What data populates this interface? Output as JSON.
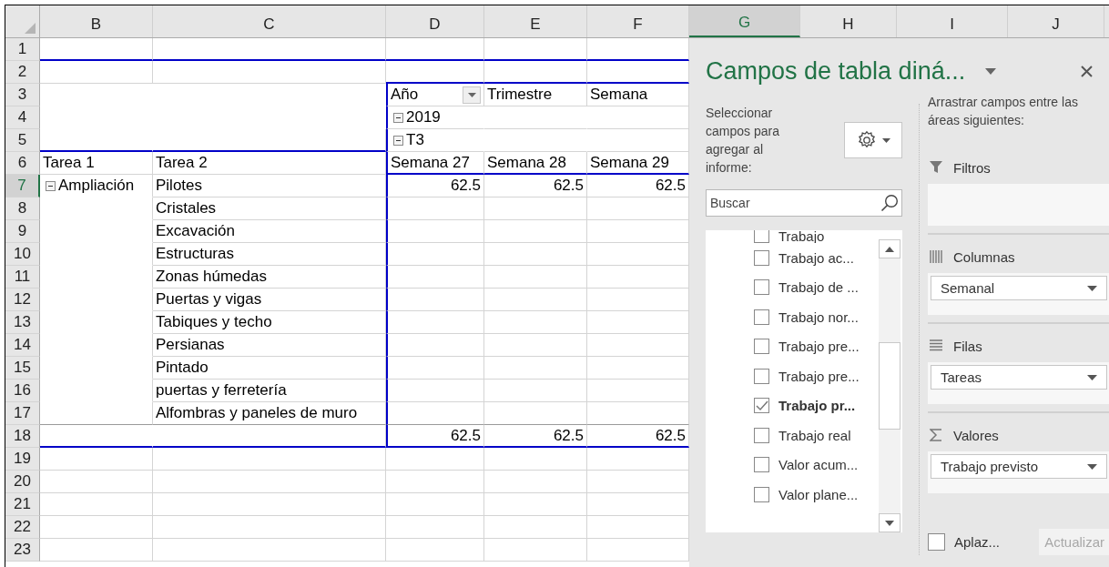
{
  "sheet": {
    "column_headers": [
      {
        "label": "B",
        "selected": false
      },
      {
        "label": "C",
        "selected": false
      },
      {
        "label": "D",
        "selected": false
      },
      {
        "label": "E",
        "selected": false
      },
      {
        "label": "F",
        "selected": false
      },
      {
        "label": "G",
        "selected": true
      },
      {
        "label": "H",
        "selected": false
      },
      {
        "label": "I",
        "selected": false
      },
      {
        "label": "J",
        "selected": false
      }
    ],
    "rows": [
      {
        "number": "1",
        "selected": false,
        "cells": [
          null,
          null,
          null,
          null,
          null
        ]
      },
      {
        "number": "2",
        "selected": false,
        "cells": [
          null,
          null,
          null,
          null,
          null
        ]
      },
      {
        "number": "3",
        "selected": false,
        "cells": [
          null,
          null,
          {
            "kind": "filter-header",
            "text": "Año"
          },
          {
            "kind": "label",
            "text": "Trimestre"
          },
          {
            "kind": "label",
            "text": "Semana"
          }
        ]
      },
      {
        "number": "4",
        "selected": false,
        "cells": [
          null,
          null,
          {
            "kind": "toggle",
            "text": "2019",
            "expanded": true
          },
          null,
          null
        ]
      },
      {
        "number": "5",
        "selected": false,
        "cells": [
          null,
          null,
          {
            "kind": "toggle",
            "text": "T3",
            "expanded": true
          },
          null,
          null
        ]
      },
      {
        "number": "6",
        "selected": false,
        "cells": [
          {
            "kind": "label",
            "text": "Tarea  1"
          },
          {
            "kind": "label",
            "text": "Tarea  2"
          },
          {
            "kind": "label",
            "text": "Semana 27"
          },
          {
            "kind": "label",
            "text": "Semana 28"
          },
          {
            "kind": "label",
            "text": "Semana 29"
          }
        ]
      },
      {
        "number": "7",
        "selected": true,
        "cells": [
          {
            "kind": "toggle",
            "text": "Ampliación",
            "expanded": true
          },
          {
            "kind": "label",
            "text": "Pilotes"
          },
          {
            "kind": "number",
            "text": "62.5"
          },
          {
            "kind": "number",
            "text": "62.5"
          },
          {
            "kind": "number",
            "text": "62.5"
          }
        ]
      },
      {
        "number": "8",
        "selected": false,
        "cells": [
          null,
          {
            "kind": "label",
            "text": "Cristales"
          },
          null,
          null,
          null
        ]
      },
      {
        "number": "9",
        "selected": false,
        "cells": [
          null,
          {
            "kind": "label",
            "text": "Excavación"
          },
          null,
          null,
          null
        ]
      },
      {
        "number": "10",
        "selected": false,
        "cells": [
          null,
          {
            "kind": "label",
            "text": "Estructuras"
          },
          null,
          null,
          null
        ]
      },
      {
        "number": "11",
        "selected": false,
        "cells": [
          null,
          {
            "kind": "label",
            "text": "Zonas húmedas"
          },
          null,
          null,
          null
        ]
      },
      {
        "number": "12",
        "selected": false,
        "cells": [
          null,
          {
            "kind": "label",
            "text": "Puertas y vigas"
          },
          null,
          null,
          null
        ]
      },
      {
        "number": "13",
        "selected": false,
        "cells": [
          null,
          {
            "kind": "label",
            "text": "Tabiques y techo"
          },
          null,
          null,
          null
        ]
      },
      {
        "number": "14",
        "selected": false,
        "cells": [
          null,
          {
            "kind": "label",
            "text": "Persianas"
          },
          null,
          null,
          null
        ]
      },
      {
        "number": "15",
        "selected": false,
        "cells": [
          null,
          {
            "kind": "label",
            "text": "Pintado"
          },
          null,
          null,
          null
        ]
      },
      {
        "number": "16",
        "selected": false,
        "cells": [
          null,
          {
            "kind": "label",
            "text": "puertas y ferretería"
          },
          null,
          null,
          null
        ]
      },
      {
        "number": "17",
        "selected": false,
        "cells": [
          null,
          {
            "kind": "label",
            "text": "Alfombras y paneles de muro"
          },
          null,
          null,
          null
        ]
      },
      {
        "number": "18",
        "selected": false,
        "cells": [
          null,
          null,
          {
            "kind": "number",
            "text": "62.5"
          },
          {
            "kind": "number",
            "text": "62.5"
          },
          {
            "kind": "number",
            "text": "62.5"
          }
        ]
      },
      {
        "number": "19",
        "selected": false,
        "cells": [
          null,
          null,
          null,
          null,
          null
        ]
      },
      {
        "number": "20",
        "selected": false,
        "cells": [
          null,
          null,
          null,
          null,
          null
        ]
      },
      {
        "number": "21",
        "selected": false,
        "cells": [
          null,
          null,
          null,
          null,
          null
        ]
      },
      {
        "number": "22",
        "selected": false,
        "cells": [
          null,
          null,
          null,
          null,
          null
        ]
      },
      {
        "number": "23",
        "selected": false,
        "cells": [
          null,
          null,
          null,
          null,
          null
        ]
      }
    ]
  },
  "pivot_pane": {
    "title": "Campos de tabla diná...",
    "field_prompt": "Seleccionar campos para agregar al informe:",
    "search": {
      "placeholder": "Buscar"
    },
    "fields": [
      {
        "label": "Trabajo",
        "checked": false
      },
      {
        "label": "Trabajo ac...",
        "checked": false
      },
      {
        "label": "Trabajo de ...",
        "checked": false
      },
      {
        "label": "Trabajo nor...",
        "checked": false
      },
      {
        "label": "Trabajo pre...",
        "checked": false
      },
      {
        "label": "Trabajo pre...",
        "checked": false
      },
      {
        "label": "Trabajo pr...",
        "checked": true
      },
      {
        "label": "Trabajo real",
        "checked": false
      },
      {
        "label": "Valor acum...",
        "checked": false
      },
      {
        "label": "Valor plane...",
        "checked": false
      }
    ],
    "areas_prompt": "Arrastrar campos entre las áreas siguientes:",
    "areas": [
      {
        "kind": "filters",
        "label": "Filtros"
      },
      {
        "kind": "columns",
        "label": "Columnas",
        "field": "Semanal"
      },
      {
        "kind": "rows",
        "label": "Filas",
        "field": "Tareas"
      },
      {
        "kind": "values",
        "label": "Valores",
        "field": "Trabajo previsto"
      }
    ],
    "defer_update": {
      "label": "Aplaz...",
      "checked": false
    },
    "update_button": {
      "label": "Actualizar",
      "disabled": true
    }
  }
}
